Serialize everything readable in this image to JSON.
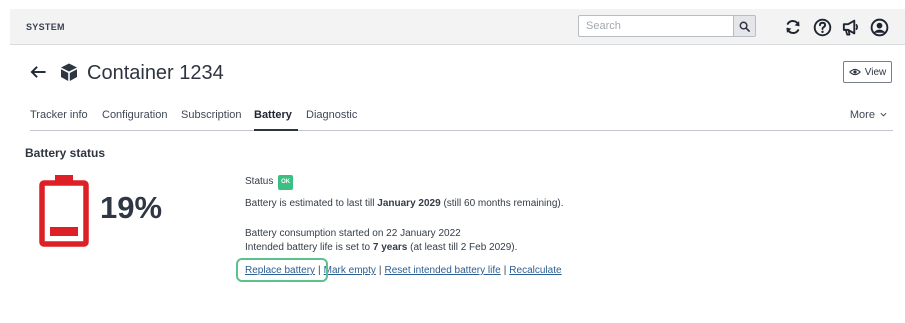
{
  "topbar": {
    "system_label": "SYSTEM",
    "search_placeholder": "Search",
    "icons": [
      "search-icon",
      "refresh-icon",
      "help-icon",
      "announcement-icon",
      "user-icon"
    ]
  },
  "header": {
    "title": "Container 1234",
    "view_label": "View",
    "icons": [
      "back-arrow-icon",
      "cube-icon",
      "eye-icon"
    ]
  },
  "tabs": {
    "items": [
      "Tracker info",
      "Configuration",
      "Subscription",
      "Battery",
      "Diagnostic"
    ],
    "active": "Battery",
    "more_label": "More"
  },
  "battery": {
    "section_title": "Battery status",
    "percent_text": "19%",
    "level_percent": 19,
    "status_label": "Status",
    "status_badge": "OK",
    "estimate_prefix": "Battery is estimated to last till ",
    "estimate_date": "January 2029",
    "estimate_suffix": " (still 60 months remaining).",
    "consumption_text": "Battery consumption started on 22 January 2022",
    "intended_prefix": "Intended battery life is set to ",
    "intended_years": "7 years",
    "intended_suffix": " (at least till 2 Feb 2029).",
    "actions": {
      "replace": "Replace battery",
      "mark_empty": "Mark empty",
      "reset": "Reset intended battery life",
      "recalculate": "Recalculate",
      "separator": "|"
    }
  },
  "colors": {
    "battery_critical": "#dd1f26",
    "status_ok": "#3bbf83",
    "link": "#2c5e93",
    "highlight": "#5cc28d"
  }
}
